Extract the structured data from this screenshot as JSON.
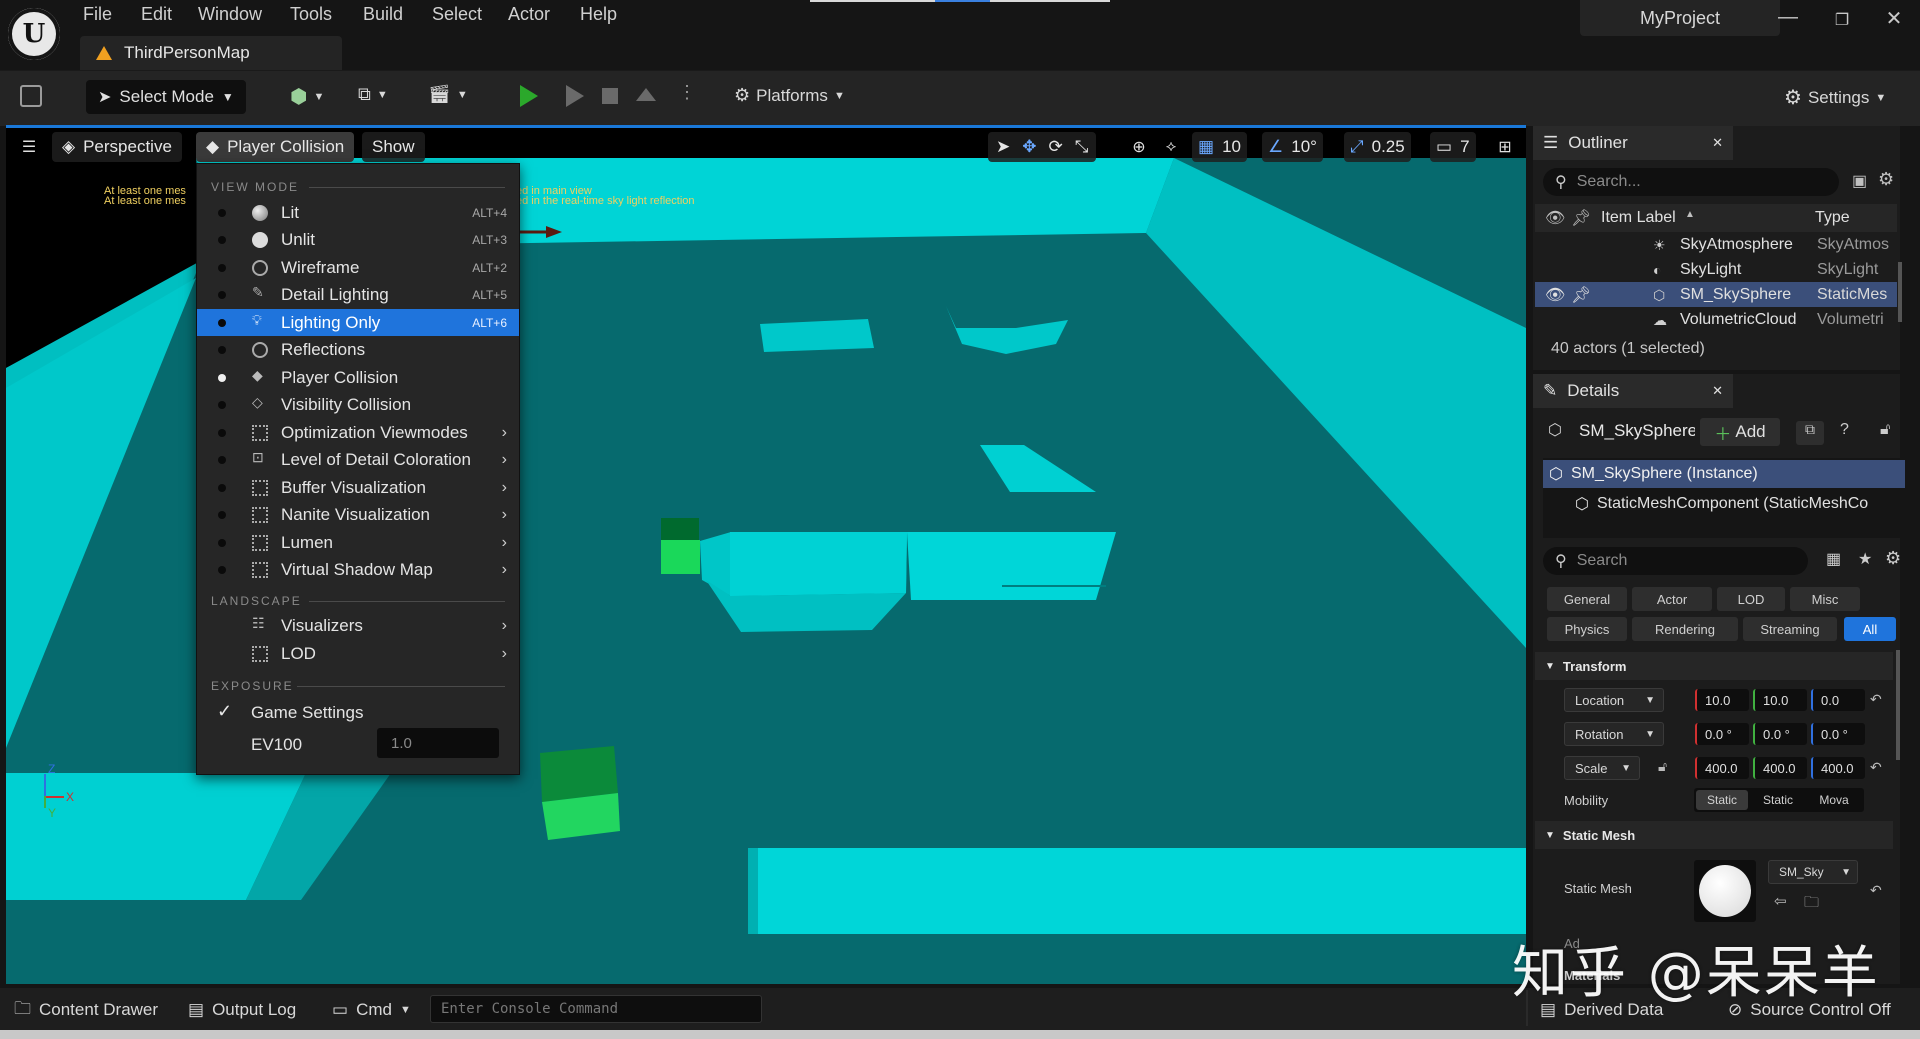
{
  "menubar": {
    "items": [
      "File",
      "Edit",
      "Window",
      "Tools",
      "Build",
      "Select",
      "Actor",
      "Help"
    ],
    "map_tab": "ThirdPersonMap",
    "project": "MyProject"
  },
  "toolbar": {
    "select_mode": "Select Mode",
    "platforms": "Platforms",
    "settings": "Settings"
  },
  "viewport": {
    "perspective": "Perspective",
    "view_mode": "Player Collision",
    "show": "Show",
    "grid_snap": "10",
    "rot_snap": "10°",
    "scale_snap": "0.25",
    "camera_speed": "7",
    "warning_line1": "At least one mes",
    "warning_line2": "At least one mes",
    "warning_tail1": "ed in main view",
    "warning_tail2": "ed in the real-time sky light reflection"
  },
  "view_mode_menu": {
    "section_view_mode": "VIEW MODE",
    "items": [
      {
        "label": "Lit",
        "shortcut": "ALT+4"
      },
      {
        "label": "Unlit",
        "shortcut": "ALT+3"
      },
      {
        "label": "Wireframe",
        "shortcut": "ALT+2"
      },
      {
        "label": "Detail Lighting",
        "shortcut": "ALT+5"
      },
      {
        "label": "Lighting Only",
        "shortcut": "ALT+6"
      },
      {
        "label": "Reflections",
        "shortcut": ""
      },
      {
        "label": "Player Collision",
        "shortcut": ""
      },
      {
        "label": "Visibility Collision",
        "shortcut": ""
      },
      {
        "label": "Optimization Viewmodes",
        "shortcut": ""
      },
      {
        "label": "Level of Detail Coloration",
        "shortcut": ""
      },
      {
        "label": "Buffer Visualization",
        "shortcut": ""
      },
      {
        "label": "Nanite Visualization",
        "shortcut": ""
      },
      {
        "label": "Lumen",
        "shortcut": ""
      },
      {
        "label": "Virtual Shadow Map",
        "shortcut": ""
      }
    ],
    "section_landscape": "LANDSCAPE",
    "landscape_items": [
      "Visualizers",
      "LOD"
    ],
    "section_exposure": "EXPOSURE",
    "game_settings": "Game Settings",
    "ev100_label": "EV100",
    "ev100_value": "1.0"
  },
  "outliner": {
    "title": "Outliner",
    "search_placeholder": "Search...",
    "col_label": "Item Label",
    "col_type": "Type",
    "rows": [
      {
        "name": "SkyAtmosphere",
        "type": "SkyAtmos"
      },
      {
        "name": "SkyLight",
        "type": "SkyLight"
      },
      {
        "name": "SM_SkySphere",
        "type": "StaticMes"
      },
      {
        "name": "VolumetricCloud",
        "type": "Volumetri"
      }
    ],
    "actor_count": "40 actors (1 selected)"
  },
  "details": {
    "title": "Details",
    "object_name": "SM_SkySphere",
    "add_label": "Add",
    "instance": "SM_SkySphere (Instance)",
    "component": "StaticMeshComponent (StaticMeshCo",
    "search_placeholder": "Search",
    "filters_row1": [
      "General",
      "Actor",
      "LOD",
      "Misc"
    ],
    "filters_row2": [
      "Physics",
      "Rendering",
      "Streaming",
      "All"
    ],
    "transform_header": "Transform",
    "location_label": "Location",
    "location": [
      "10.0",
      "10.0",
      "0.0"
    ],
    "rotation_label": "Rotation",
    "rotation": [
      "0.0 °",
      "0.0 °",
      "0.0 °"
    ],
    "scale_label": "Scale",
    "scale": [
      "400.0",
      "400.0",
      "400.0"
    ],
    "mobility_label": "Mobility",
    "mobility_options": [
      "Static",
      "Static",
      "Mova"
    ],
    "static_mesh_header": "Static Mesh",
    "static_mesh_label": "Static Mesh",
    "static_mesh_value": "SM_Sky",
    "advanced_label": "Ad",
    "materials_label": "Materials"
  },
  "statusbar": {
    "content_drawer": "Content Drawer",
    "output_log": "Output Log",
    "cmd": "Cmd",
    "console_placeholder": "Enter Console Command",
    "derived_data": "Derived Data",
    "source_control": "Source Control Off"
  },
  "watermark": "知乎 @呆呆羊",
  "colors": {
    "accent": "#1f74dc",
    "floor": "#066a6e",
    "walls": "#00d7d8",
    "green_box": "#1ec85a",
    "play_green": "#2ba82b"
  }
}
